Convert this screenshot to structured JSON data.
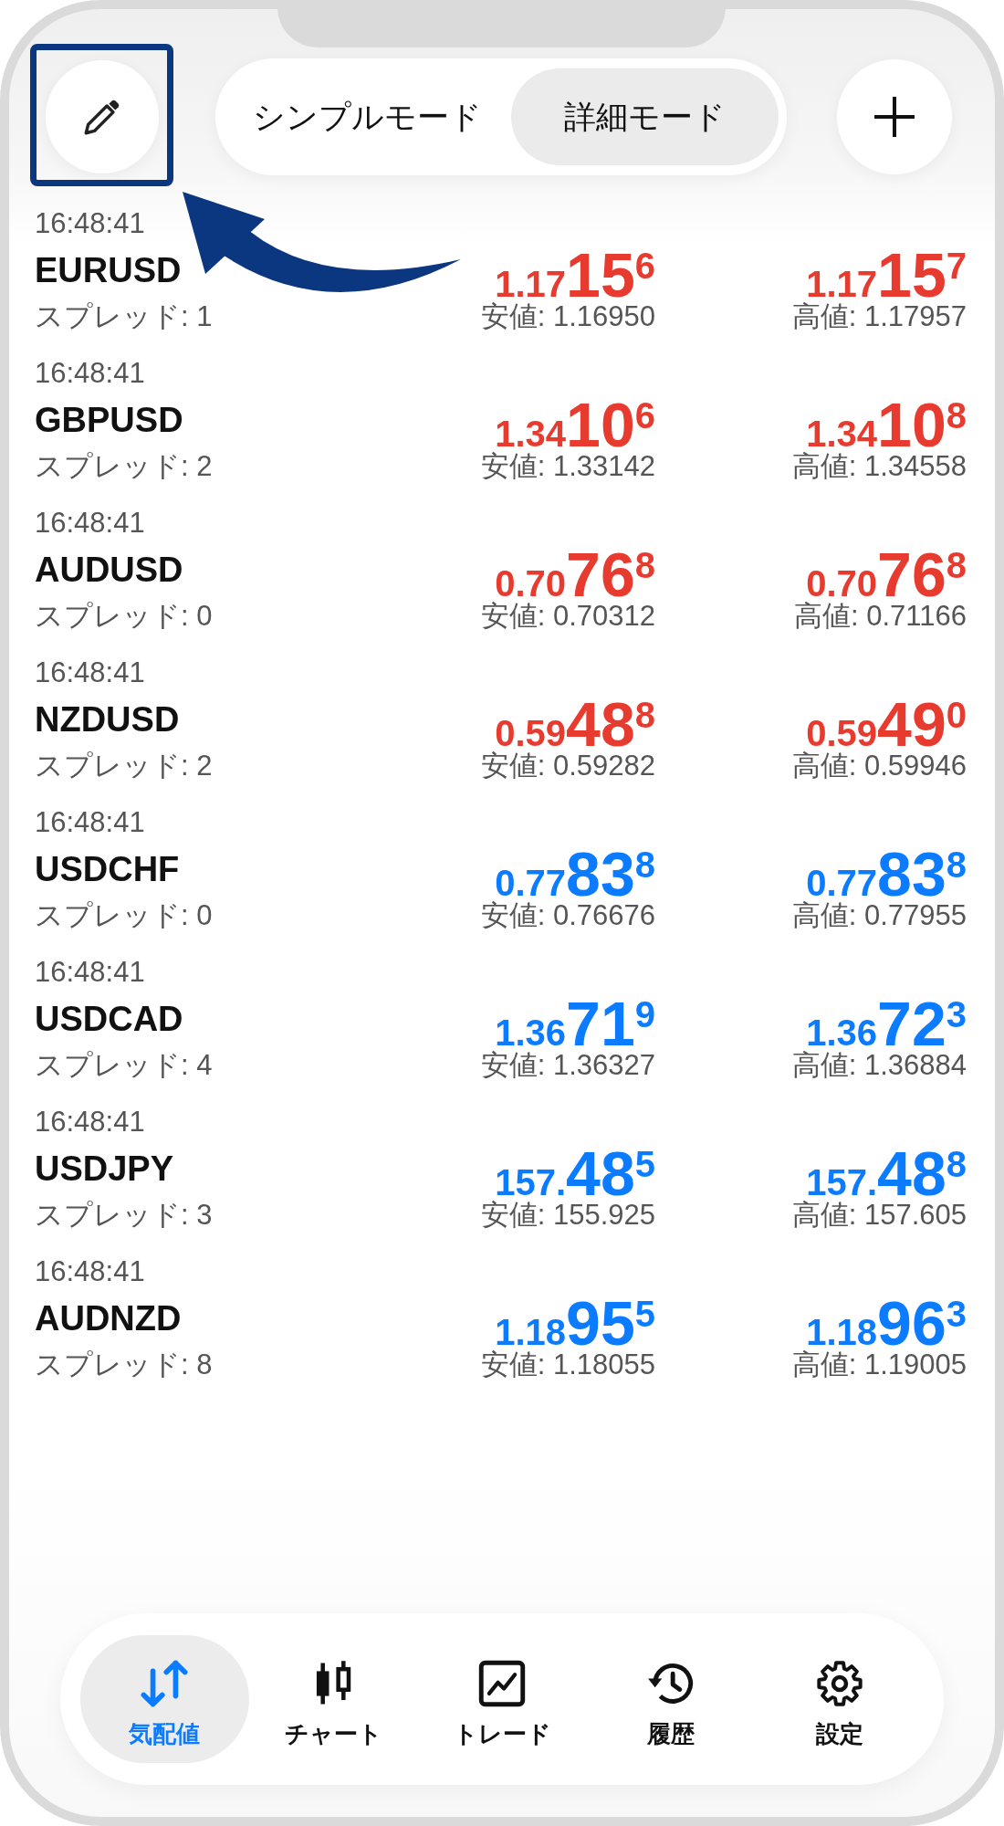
{
  "header": {
    "modes": [
      {
        "label": "シンプルモード",
        "selected": false
      },
      {
        "label": "詳細モード",
        "selected": true
      }
    ]
  },
  "quotes": [
    {
      "time": "16:48:41",
      "symbol": "EURUSD",
      "spread": "スプレッド: 1",
      "color": "#e63b2e",
      "bid": {
        "head": "1.17",
        "pips": "15",
        "tail": "6"
      },
      "low": "安値: 1.16950",
      "ask": {
        "head": "1.17",
        "pips": "15",
        "tail": "7"
      },
      "high": "高値: 1.17957"
    },
    {
      "time": "16:48:41",
      "symbol": "GBPUSD",
      "spread": "スプレッド: 2",
      "color": "#e63b2e",
      "bid": {
        "head": "1.34",
        "pips": "10",
        "tail": "6"
      },
      "low": "安値: 1.33142",
      "ask": {
        "head": "1.34",
        "pips": "10",
        "tail": "8"
      },
      "high": "高値: 1.34558"
    },
    {
      "time": "16:48:41",
      "symbol": "AUDUSD",
      "spread": "スプレッド: 0",
      "color": "#e63b2e",
      "bid": {
        "head": "0.70",
        "pips": "76",
        "tail": "8"
      },
      "low": "安値: 0.70312",
      "ask": {
        "head": "0.70",
        "pips": "76",
        "tail": "8"
      },
      "high": "高値: 0.71166"
    },
    {
      "time": "16:48:41",
      "symbol": "NZDUSD",
      "spread": "スプレッド: 2",
      "color": "#e63b2e",
      "bid": {
        "head": "0.59",
        "pips": "48",
        "tail": "8"
      },
      "low": "安値: 0.59282",
      "ask": {
        "head": "0.59",
        "pips": "49",
        "tail": "0"
      },
      "high": "高値: 0.59946"
    },
    {
      "time": "16:48:41",
      "symbol": "USDCHF",
      "spread": "スプレッド: 0",
      "color": "#0b7bff",
      "bid": {
        "head": "0.77",
        "pips": "83",
        "tail": "8"
      },
      "low": "安値: 0.76676",
      "ask": {
        "head": "0.77",
        "pips": "83",
        "tail": "8"
      },
      "high": "高値: 0.77955"
    },
    {
      "time": "16:48:41",
      "symbol": "USDCAD",
      "spread": "スプレッド: 4",
      "color": "#0b7bff",
      "bid": {
        "head": "1.36",
        "pips": "71",
        "tail": "9"
      },
      "low": "安値: 1.36327",
      "ask": {
        "head": "1.36",
        "pips": "72",
        "tail": "3"
      },
      "high": "高値: 1.36884"
    },
    {
      "time": "16:48:41",
      "symbol": "USDJPY",
      "spread": "スプレッド: 3",
      "color": "#0b7bff",
      "bid": {
        "head": "157.",
        "pips": "48",
        "tail": "5"
      },
      "low": "安値: 155.925",
      "ask": {
        "head": "157.",
        "pips": "48",
        "tail": "8"
      },
      "high": "高値: 157.605"
    },
    {
      "time": "16:48:41",
      "symbol": "AUDNZD",
      "spread": "スプレッド: 8",
      "color": "#0b7bff",
      "bid": {
        "head": "1.18",
        "pips": "95",
        "tail": "5"
      },
      "low": "安値: 1.18055",
      "ask": {
        "head": "1.18",
        "pips": "96",
        "tail": "3"
      },
      "high": "高値: 1.19005"
    }
  ],
  "tab_bar": [
    {
      "label": "気配値",
      "kind": "quotes",
      "selected": true
    },
    {
      "label": "チャート",
      "kind": "chart",
      "selected": false
    },
    {
      "label": "トレード",
      "kind": "trade",
      "selected": false
    },
    {
      "label": "履歴",
      "kind": "history",
      "selected": false
    },
    {
      "label": "設定",
      "kind": "settings",
      "selected": false
    }
  ]
}
